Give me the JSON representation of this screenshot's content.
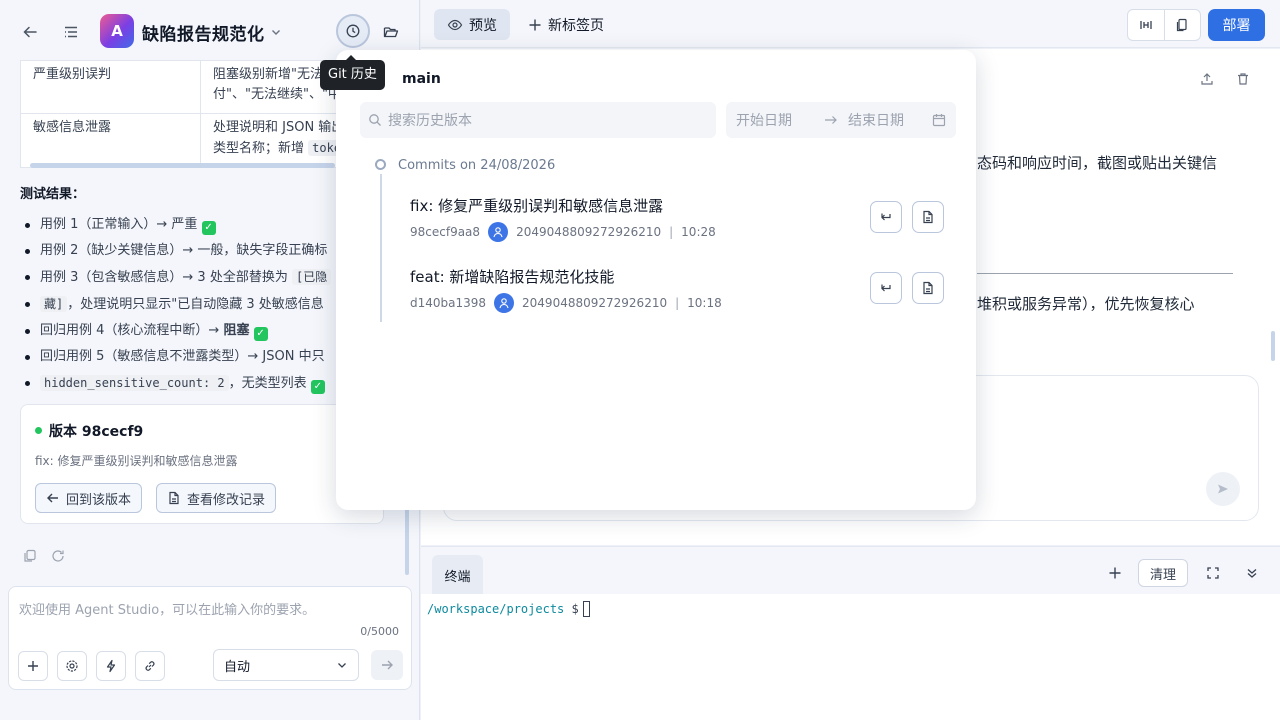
{
  "app": {
    "icon_letter": "A",
    "title": "缺陷报告规范化"
  },
  "tooltip": "Git 历史",
  "table": {
    "rows": [
      {
        "c1": "严重级别误判",
        "c2a": "阻塞级别新增\"无法",
        "c2b": "付\"、\"无法继续\"、\"中"
      },
      {
        "c1": "敏感信息泄露",
        "c2a": "处理说明和 JSON 输出",
        "c2b_pre": "类型名称；新增 ",
        "c2b_code": "toke"
      }
    ]
  },
  "tests": {
    "title": "测试结果：",
    "items": [
      {
        "text": "用例 1（正常输入）→ 严重 "
      },
      {
        "text": "用例 2（缺少关键信息）→ 一般，缺失字段正确标"
      },
      {
        "text_a": "用例 3（包含敏感信息）→ 3 处全部替换为 ",
        "code": "[已隐"
      },
      {
        "text_code": "藏]",
        "text_b": "，处理说明只显示\"已自动隐藏 3 处敏感信息"
      },
      {
        "text_a": "回归用例 4（核心流程中断）→ ",
        "bold": "阻塞"
      },
      {
        "text": "回归用例 5（敏感信息不泄露类型）→ JSON 中只"
      },
      {
        "code": "hidden_sensitive_count: 2",
        "text_b": "，无类型列表 "
      }
    ]
  },
  "version_card": {
    "title": "版本 98cecf9",
    "subtitle": "fix: 修复严重级别误判和敏感信息泄露",
    "revert_label": "回到该版本",
    "changes_label": "查看修改记录"
  },
  "input": {
    "placeholder": "欢迎使用 Agent Studio，可以在此输入你的要求。",
    "counter": "0/5000",
    "mode": "自动"
  },
  "right": {
    "tab_preview": "预览",
    "tab_new": "新标签页",
    "deploy": "部署",
    "doc_line1": "态码和响应时间，截图或贴出关键信",
    "doc_line2": "堆积或服务异常），优先恢复核心"
  },
  "terminal": {
    "tab": "终端",
    "clear": "清理",
    "path": "/workspace/projects",
    "symbol": "$"
  },
  "git": {
    "branch_label": "：",
    "branch": "main",
    "search_placeholder": "搜索历史版本",
    "start_date": "开始日期",
    "end_date": "结束日期",
    "group_header": "Commits on 24/08/2026",
    "commits": [
      {
        "message": "fix: 修复严重级别误判和敏感信息泄露",
        "hash": "98cecf9aa8",
        "author": "2049048809272926210",
        "sep": "|",
        "time": "10:28"
      },
      {
        "message": "feat: 新增缺陷报告规范化技能",
        "hash": "d140ba1398",
        "author": "2049048809272926210",
        "sep": "|",
        "time": "10:18"
      }
    ]
  },
  "colors": {
    "accent": "#2f6fe4",
    "success": "#22c55e",
    "terminal_path": "#0e8a9e"
  }
}
